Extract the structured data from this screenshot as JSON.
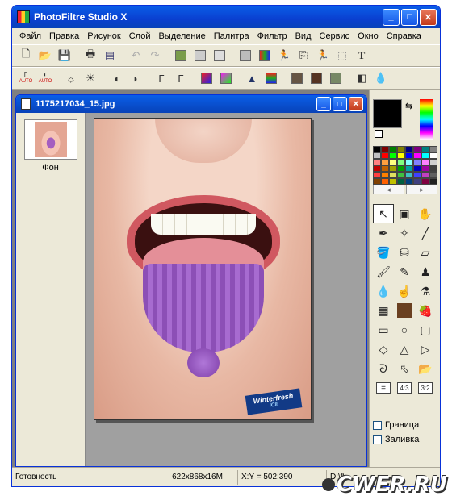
{
  "window": {
    "title": "PhotoFiltre Studio X"
  },
  "menu": [
    "Файл",
    "Правка",
    "Рисунок",
    "Слой",
    "Выделение",
    "Палитра",
    "Фильтр",
    "Вид",
    "Сервис",
    "Окно",
    "Справка"
  ],
  "toolbar1": [
    "new-icon",
    "open-icon",
    "save-icon",
    "print-icon",
    "scan-icon",
    "undo-icon",
    "redo-icon",
    "paste-icon",
    "copy-icon",
    "export-icon",
    "gray-icon",
    "color-icon",
    "figure-icon",
    "layer-icon",
    "figure2-icon",
    "select-icon",
    "text-icon"
  ],
  "toolbar2": [
    "auto-levels-icon",
    "auto-contrast-icon",
    "brightness-minus-icon",
    "brightness-plus-icon",
    "contrast-minus-icon",
    "contrast-plus-icon",
    "gamma-minus-icon",
    "gamma-plus-icon",
    "saturation-minus-icon",
    "saturation-plus-icon",
    "hue-icon",
    "rgb-icon",
    "filter1-icon",
    "filter2-icon",
    "filter3-icon",
    "mirror-icon",
    "drop-icon"
  ],
  "toolbar2_labels": {
    "auto1": "AUTO",
    "auto2": "AUTO"
  },
  "document": {
    "title": "1175217034_15.jpg",
    "layer_label": "Фон"
  },
  "image": {
    "brand_name": "Winterfresh",
    "brand_sub": "ICE"
  },
  "palette_colors": [
    "#000000",
    "#800000",
    "#008000",
    "#808000",
    "#000080",
    "#800080",
    "#008080",
    "#808080",
    "#c0c0c0",
    "#ff0000",
    "#00ff00",
    "#ffff00",
    "#0000ff",
    "#ff00ff",
    "#00ffff",
    "#ffffff",
    "#ff8080",
    "#ffa040",
    "#ffff80",
    "#80ff80",
    "#80ffff",
    "#8080ff",
    "#ff80ff",
    "#d0d0d0",
    "#c00000",
    "#c06000",
    "#a0a000",
    "#00a000",
    "#00a0a0",
    "#0000c0",
    "#a000a0",
    "#404040",
    "#ff4040",
    "#ff8000",
    "#e0e060",
    "#40c040",
    "#40c0c0",
    "#4040ff",
    "#c040c0",
    "#606060",
    "#804000",
    "#ff6000",
    "#c0c000",
    "#006040",
    "#004080",
    "#404080",
    "#800040",
    "#202020"
  ],
  "tools": [
    "select-arrow-icon",
    "stamp-icon",
    "hand-icon",
    "eyedropper-icon",
    "magic-wand-icon",
    "line-icon",
    "fill-icon",
    "spray-icon",
    "eraser-icon",
    "brush-icon",
    "pen-icon",
    "rubber-icon",
    "blur-icon",
    "smudge-icon",
    "patch-icon",
    "mosaic-icon",
    "portrait-icon",
    "strawberry-icon",
    "rect-icon",
    "ellipse-icon",
    "roundrect-icon",
    "diamond-icon",
    "triangle-icon",
    "play-icon",
    "lasso-icon",
    "polygon-icon",
    "folder-icon",
    "ratio-eq-icon",
    "ratio-43-icon",
    "ratio-32-icon"
  ],
  "tool_ratio_labels": {
    "r1": "=",
    "r2": "4:3",
    "r3": "3:2"
  },
  "options": {
    "border_label": "Граница",
    "fill_label": "Заливка"
  },
  "status": {
    "ready": "Готовность",
    "size": "622x868x16M",
    "coords": "X:Y = 502:390",
    "path": "D:\\f\\"
  },
  "watermark": "CWER.RU"
}
